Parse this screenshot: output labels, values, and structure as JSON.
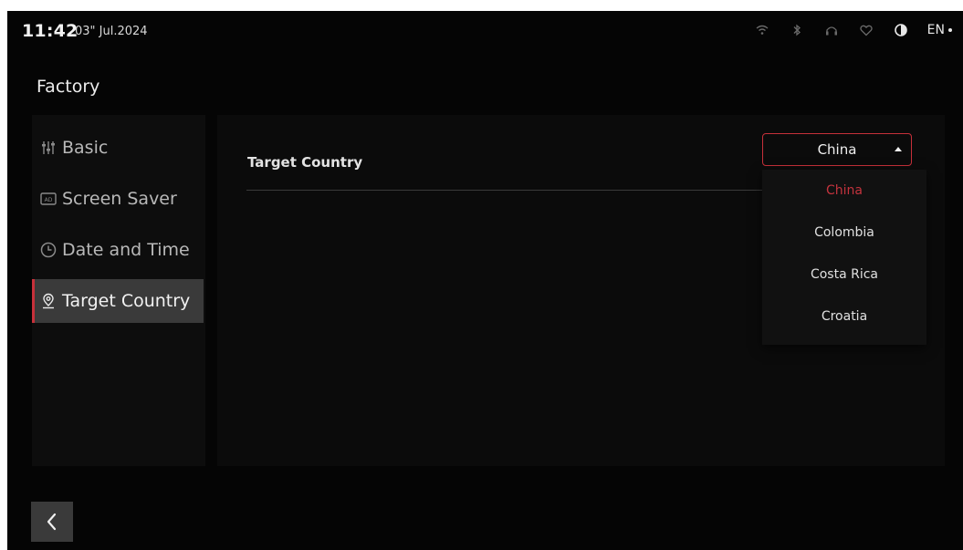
{
  "status_bar": {
    "time": "11:42",
    "date": "03\" Jul.2024",
    "icons": [
      "wifi-icon",
      "bluetooth-icon",
      "headset-icon",
      "heart-icon",
      "contrast-icon"
    ],
    "language": "EN"
  },
  "page": {
    "title": "Factory"
  },
  "sidebar": {
    "items": [
      {
        "label": "Basic",
        "icon": "sliders-icon",
        "active": false
      },
      {
        "label": "Screen Saver",
        "icon": "screen-saver-icon",
        "active": false
      },
      {
        "label": "Date and Time",
        "icon": "clock-icon",
        "active": false
      },
      {
        "label": "Target Country",
        "icon": "location-icon",
        "active": true
      }
    ]
  },
  "content": {
    "setting_label": "Target Country",
    "selected_value": "China",
    "dropdown_options": [
      "China",
      "Colombia",
      "Costa Rica",
      "Croatia"
    ],
    "selected_index": 0
  },
  "colors": {
    "accent": "#c7303a",
    "background": "#050505",
    "active_item": "#3a3a3a"
  },
  "nav": {
    "back_icon": "chevron-left-icon"
  }
}
